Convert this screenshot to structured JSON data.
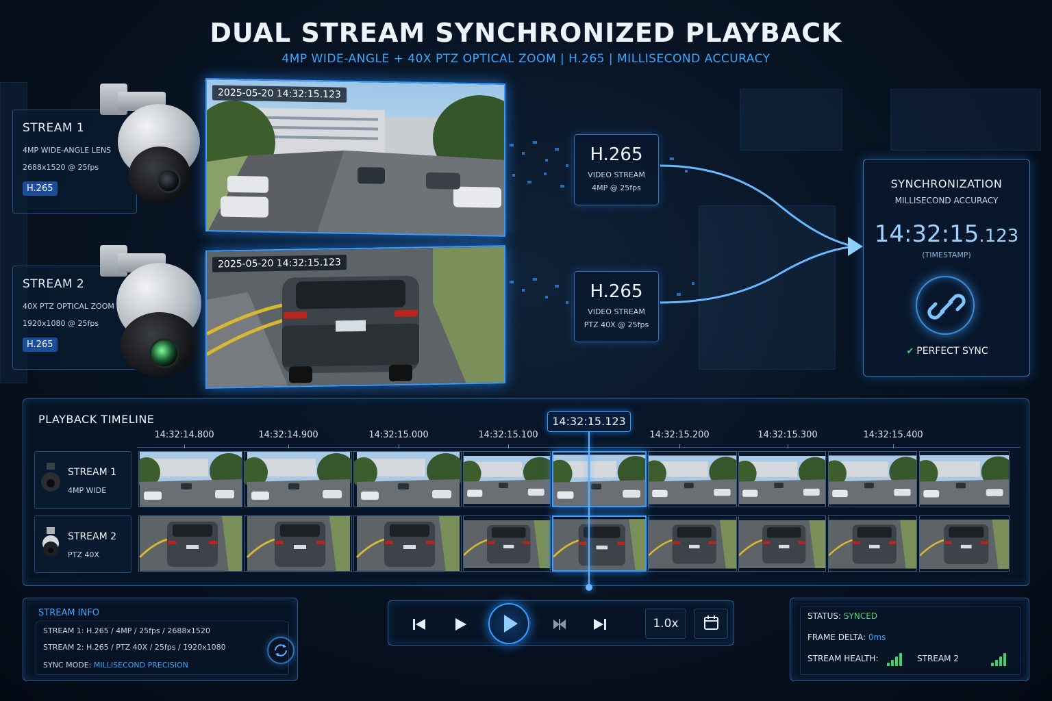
{
  "header": {
    "title": "DUAL STREAM SYNCHRONIZED PLAYBACK",
    "subtitle": "4MP WIDE-ANGLE + 40X PTZ OPTICAL ZOOM | H.265 | MILLISECOND ACCURACY"
  },
  "streams": [
    {
      "name": "STREAM 1",
      "lens": "4MP WIDE-ANGLE LENS",
      "resolution": "2688x1520 @ 25fps",
      "codec": "H.265",
      "timestamp": "2025-05-20 14:32:15.123",
      "codec_box": {
        "codec": "H.265",
        "line1": "VIDEO STREAM",
        "line2": "4MP @ 25fps"
      }
    },
    {
      "name": "STREAM 2",
      "lens": "40X PTZ OPTICAL ZOOM",
      "resolution": "1920x1080 @ 25fps",
      "codec": "H.265",
      "timestamp": "2025-05-20 14:32:15.123",
      "codec_box": {
        "codec": "H.265",
        "line1": "VIDEO STREAM",
        "line2": "PTZ 40X @ 25fps"
      }
    }
  ],
  "sync": {
    "title": "SYNCHRONIZATION",
    "subtitle": "MILLISECOND ACCURACY",
    "time_main": "14:32:15",
    "time_ms": ".123",
    "time_caption": "(TIMESTAMP)",
    "status": "PERFECT SYNC",
    "icon": "link-icon"
  },
  "timeline": {
    "title": "PLAYBACK TIMELINE",
    "current": "14:32:15.123",
    "ticks": [
      "14:32:14.800",
      "14:32:14.900",
      "14:32:15.000",
      "14:32:15.100",
      "14:32:15.200",
      "14:32:15.300",
      "14:32:15.400"
    ],
    "tracks": [
      {
        "name": "STREAM 1",
        "sub": "4MP WIDE"
      },
      {
        "name": "STREAM 2",
        "sub": "PTZ 40X"
      }
    ]
  },
  "stream_info": {
    "title": "STREAM INFO",
    "line1": "STREAM 1: H.265 / 4MP / 25fps / 2688x1520",
    "line2": "STREAM 2: H.265 / PTZ 40X / 25fps / 1920x1080",
    "sync_mode_label": "SYNC MODE:",
    "sync_mode_value": "MILLISECOND PRECISION"
  },
  "controls": {
    "speed": "1.0x",
    "icons": [
      "skip-back-icon",
      "play-icon",
      "play-main-icon",
      "step-frame-icon",
      "skip-forward-icon",
      "calendar-icon"
    ]
  },
  "status": {
    "status_label": "STATUS:",
    "status_value": "SYNCED",
    "delta_label": "FRAME DELTA:",
    "delta_value": "0ms",
    "health_label": "STREAM HEALTH:",
    "stream2_label": "STREAM 2"
  },
  "colors": {
    "accent": "#3a9cff",
    "ok": "#4fd37a",
    "background": "#081424"
  }
}
